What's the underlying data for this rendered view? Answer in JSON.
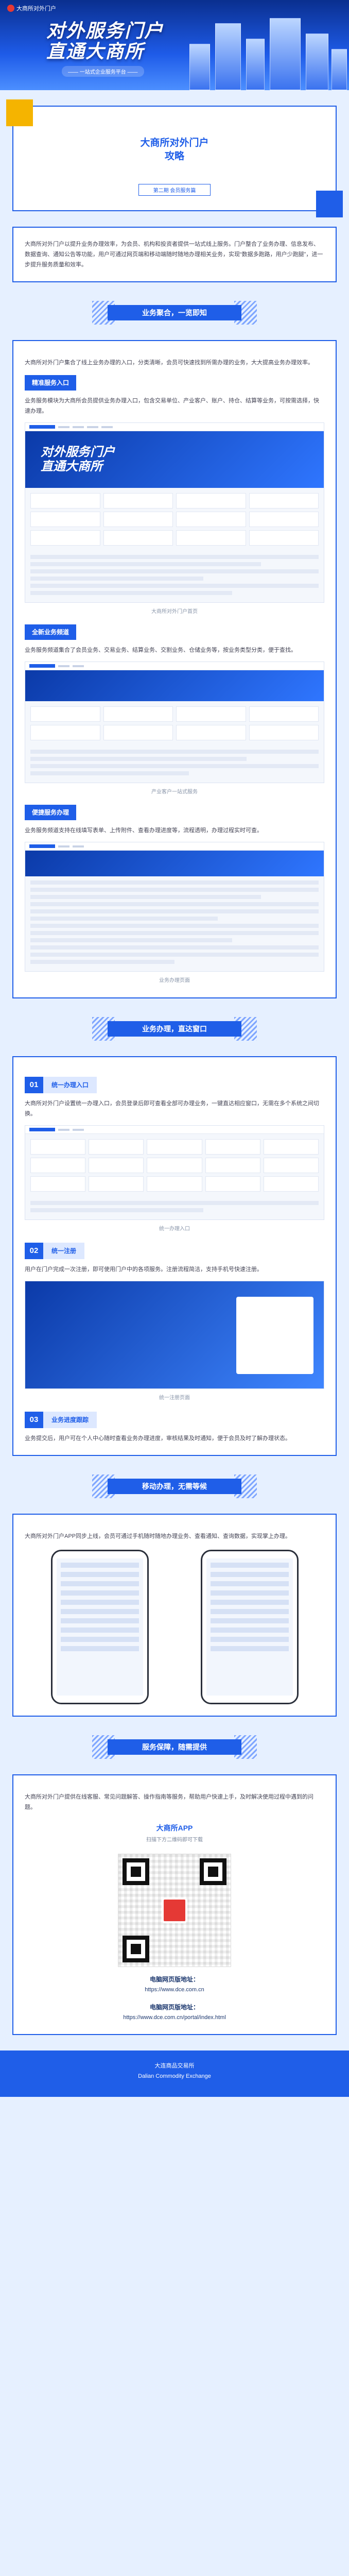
{
  "hero": {
    "logo_text": "大商所对外门户",
    "title_line1": "对外服务门户",
    "title_line2": "直通大商所",
    "subtitle": "—— 一站式企业服务平台 ——"
  },
  "title_card": {
    "title_line1": "大商所对外门户",
    "title_line2": "攻略",
    "sub": "第二期 会员服务篇"
  },
  "intro": "大商所对外门户以提升业务办理效率，为会员、机构和投资者提供一站式线上服务。门户整合了业务办理、信息发布、数据查询、通知公告等功能，用户可通过网页端和移动端随时随地办理相关业务，实现“数据多跑路，用户少跑腿”，进一步提升服务质量和效率。",
  "sec1": {
    "title": "业务聚合，一览即知",
    "text": "大商所对外门户集合了线上业务办理的入口，分类清晰，会员可快速找到所需办理的业务，大大提高业务办理效率。",
    "item1_label": "精准服务入口",
    "item1_text": "业务服务模块为大商所会员提供业务办理入口，包含交易单位、产业客户、账户、持仓、结算等业务，可按需选择，快速办理。",
    "caption1": "大商所对外门户首页",
    "item2_label": "全新业务频道",
    "item2_text": "业务服务频道集合了会员业务、交易业务、结算业务、交割业务、仓储业务等，按业务类型分类，便于查找。",
    "caption2": "产业客户一站式服务",
    "item3_label": "便捷服务办理",
    "item3_text": "业务服务频道支持在线填写表单、上传附件、查看办理进度等，流程透明，办理过程实时可查。",
    "caption3": "业务办理页面"
  },
  "sec2": {
    "title": "业务办理，直达窗口",
    "n1": "01",
    "n1_label": "统一办理入口",
    "n1_text": "大商所对外门户设置统一办理入口，会员登录后即可查看全部可办理业务，一键直达相应窗口，无需在多个系统之间切换。",
    "caption1": "统一办理入口",
    "n2": "02",
    "n2_label": "统一注册",
    "n2_text": "用户在门户完成一次注册，即可使用门户中的各项服务。注册流程简洁，支持手机号快速注册。",
    "caption2": "统一注册页面",
    "n3": "03",
    "n3_label": "业务进度跟踪",
    "n3_text": "业务提交后，用户可在个人中心随时查看业务办理进度，审核结果及时通知，便于会员及时了解办理状态。"
  },
  "sec3": {
    "title": "移动办理，无需等候",
    "text": "大商所对外门户APP同步上线，会员可通过手机随时随地办理业务、查看通知、查询数据，实现掌上办理。"
  },
  "sec4": {
    "title": "服务保障，随需提供",
    "text": "大商所对外门户提供在线客服、常见问题解答、操作指南等服务，帮助用户快速上手，及时解决使用过程中遇到的问题。",
    "app_title": "大商所APP",
    "app_sub": "扫描下方二维码即可下载",
    "web_label": "电脑网页版地址：",
    "web_url": "https://www.dce.com.cn",
    "mobile_label": "电脑网页版地址：",
    "mobile_url": "https://www.dce.com.cn/portal/index.html"
  },
  "footer": {
    "line1": "大连商品交易所",
    "line2": "Dalian Commodity Exchange"
  }
}
